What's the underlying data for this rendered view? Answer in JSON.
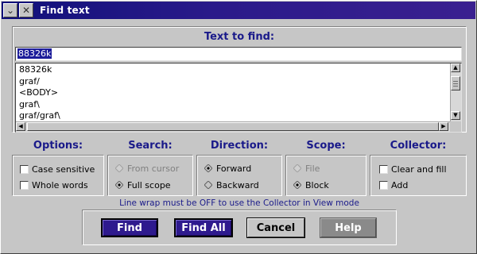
{
  "window": {
    "title": "Find text",
    "menu_icon": "chevron-down-icon",
    "close_icon": "close-icon"
  },
  "find": {
    "heading": "Text to find:",
    "input_value": "88326k",
    "history": [
      "88326k",
      "graf/",
      "<BODY>",
      "graf\\",
      "graf/graf\\"
    ]
  },
  "options": {
    "heading": "Options:",
    "case_sensitive": {
      "label": "Case sensitive",
      "checked": false
    },
    "whole_words": {
      "label": "Whole words",
      "checked": false
    }
  },
  "search": {
    "heading": "Search:",
    "from_cursor": {
      "label": "From cursor",
      "selected": false
    },
    "full_scope": {
      "label": "Full scope",
      "selected": true
    }
  },
  "direction": {
    "heading": "Direction:",
    "forward": {
      "label": "Forward",
      "selected": true
    },
    "backward": {
      "label": "Backward",
      "selected": false
    }
  },
  "scope": {
    "heading": "Scope:",
    "file": {
      "label": "File",
      "selected": false
    },
    "block": {
      "label": "Block",
      "selected": true
    }
  },
  "collector": {
    "heading": "Collector:",
    "clear_and_fill": {
      "label": "Clear and fill",
      "checked": false
    },
    "add": {
      "label": "Add",
      "checked": false
    }
  },
  "note": "Line wrap must be OFF to use the Collector in View mode",
  "buttons": {
    "find": "Find",
    "find_all": "Find All",
    "cancel": "Cancel",
    "help": "Help"
  },
  "colors": {
    "titlebar": "#10107a",
    "accent_text": "#1a1a8a",
    "primary_button": "#2e1a8e",
    "selection": "#1c1c9a"
  }
}
